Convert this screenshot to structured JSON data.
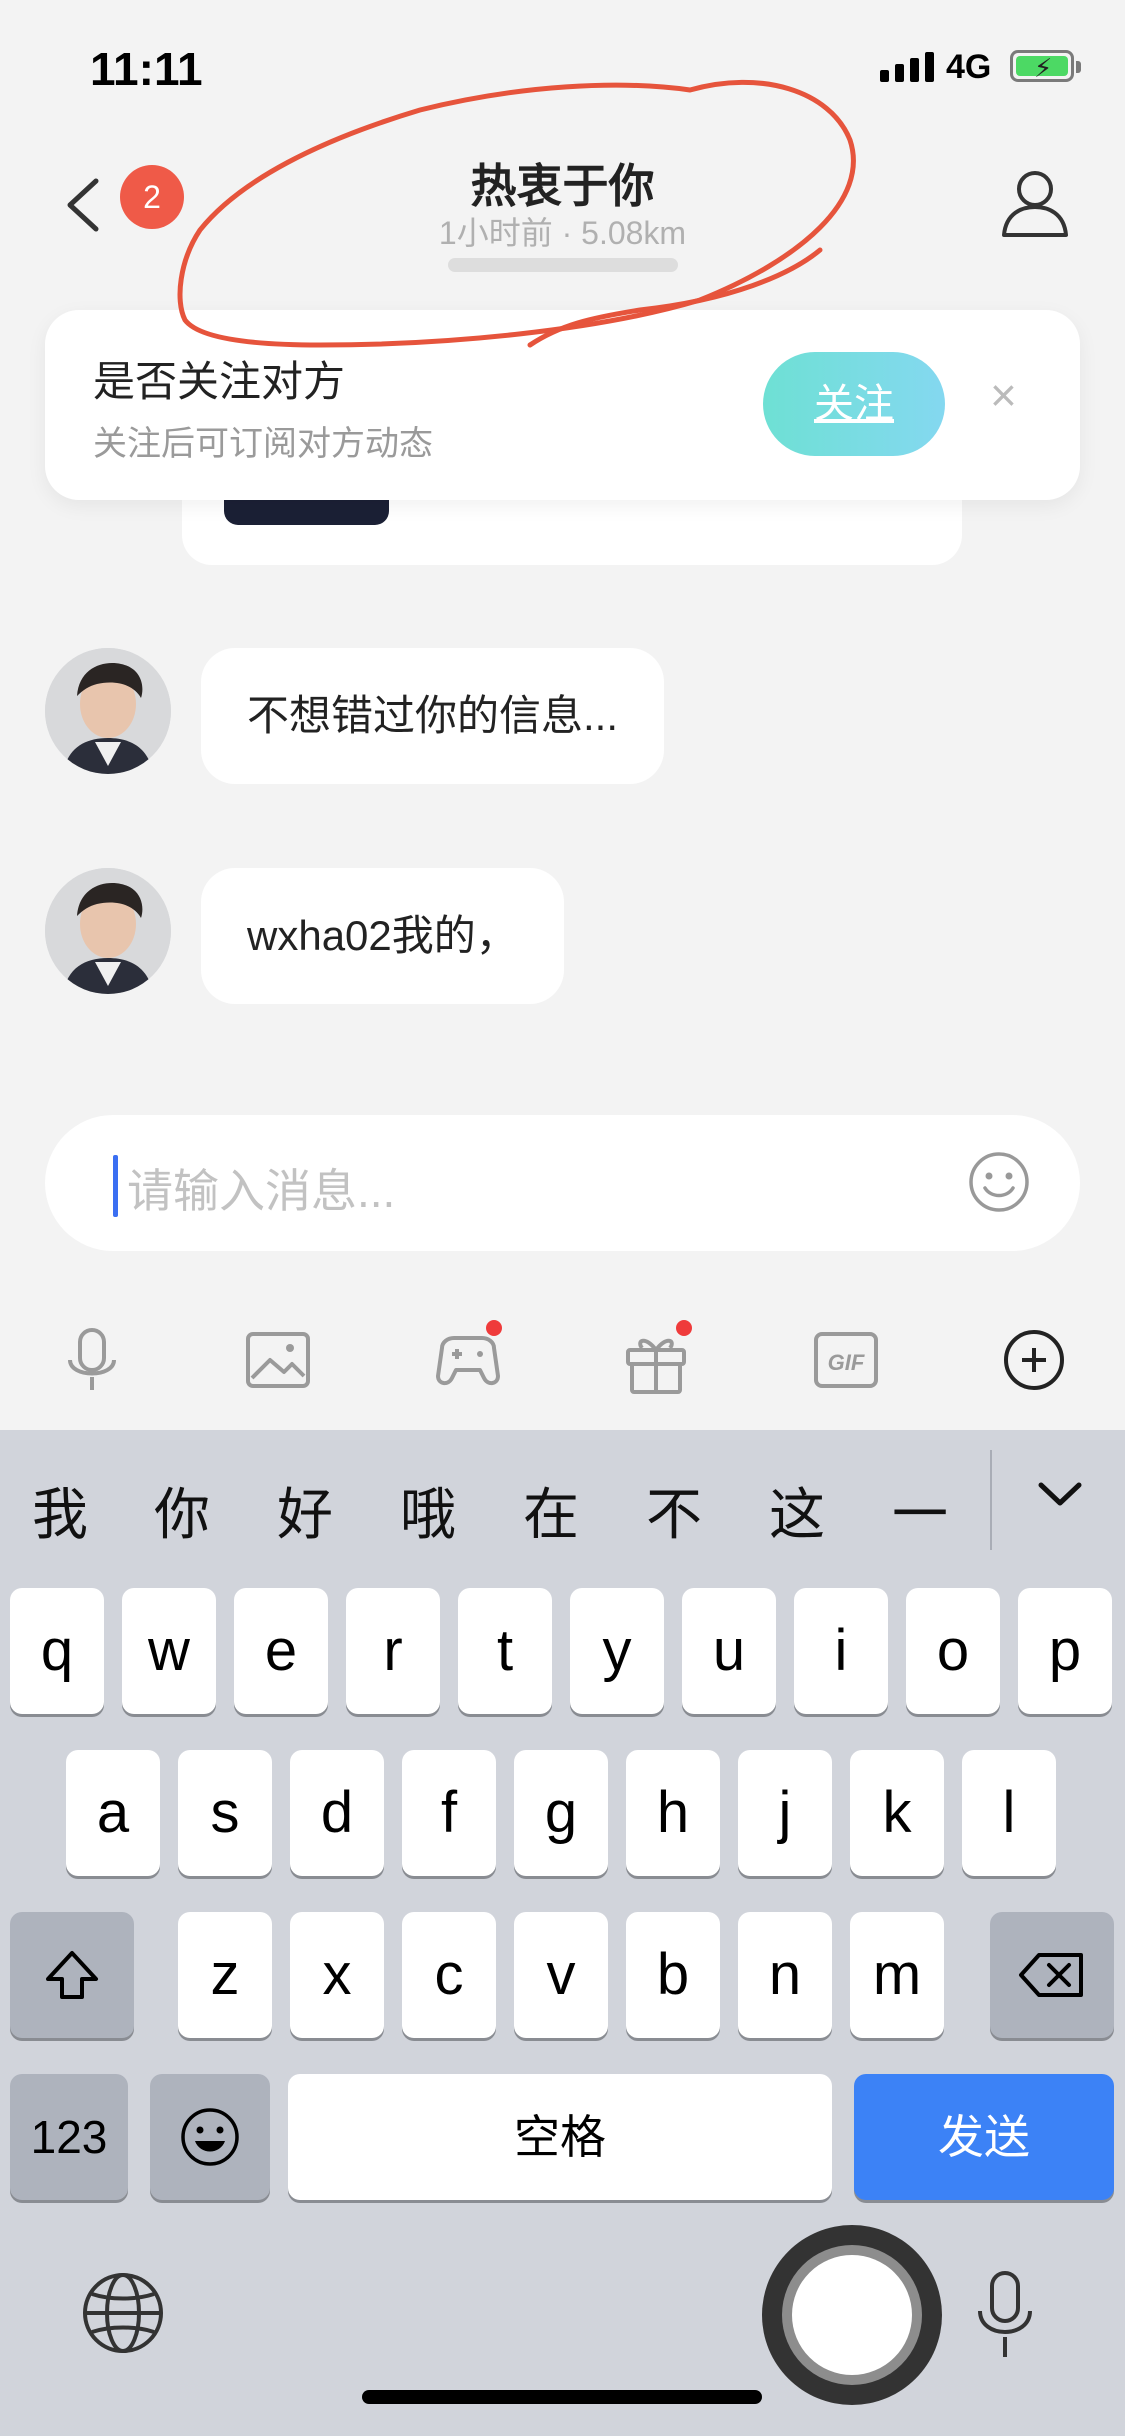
{
  "status": {
    "time": "11:11",
    "network": "4G"
  },
  "nav": {
    "badge_count": "2",
    "title": "热衷于你",
    "subtitle": "1小时前 · 5.08km"
  },
  "follow_prompt": {
    "title": "是否关注对方",
    "subtitle": "关注后可订阅对方动态",
    "button": "关注",
    "close": "×"
  },
  "messages": [
    {
      "text": "不想错过你的信息..."
    },
    {
      "text": "wxha02我的，"
    }
  ],
  "input": {
    "placeholder": "请输入消息..."
  },
  "toolbar": {
    "items": [
      "microphone-icon",
      "image-icon",
      "gamepad-icon",
      "gift-icon",
      "gif-icon",
      "plus-icon"
    ]
  },
  "keyboard": {
    "candidates": [
      "我",
      "你",
      "好",
      "哦",
      "在",
      "不",
      "这",
      "一"
    ],
    "row1": [
      "q",
      "w",
      "e",
      "r",
      "t",
      "y",
      "u",
      "i",
      "o",
      "p"
    ],
    "row2": [
      "a",
      "s",
      "d",
      "f",
      "g",
      "h",
      "j",
      "k",
      "l"
    ],
    "row3": [
      "z",
      "x",
      "c",
      "v",
      "b",
      "n",
      "m"
    ],
    "numbers_key": "123",
    "space_key": "空格",
    "send_key": "发送"
  },
  "colors": {
    "annotation": "#e6543c",
    "badge": "#ef5a48",
    "send": "#3c82f6",
    "follow_gradient_start": "#6ee0d4",
    "follow_gradient_end": "#84d8f0"
  }
}
